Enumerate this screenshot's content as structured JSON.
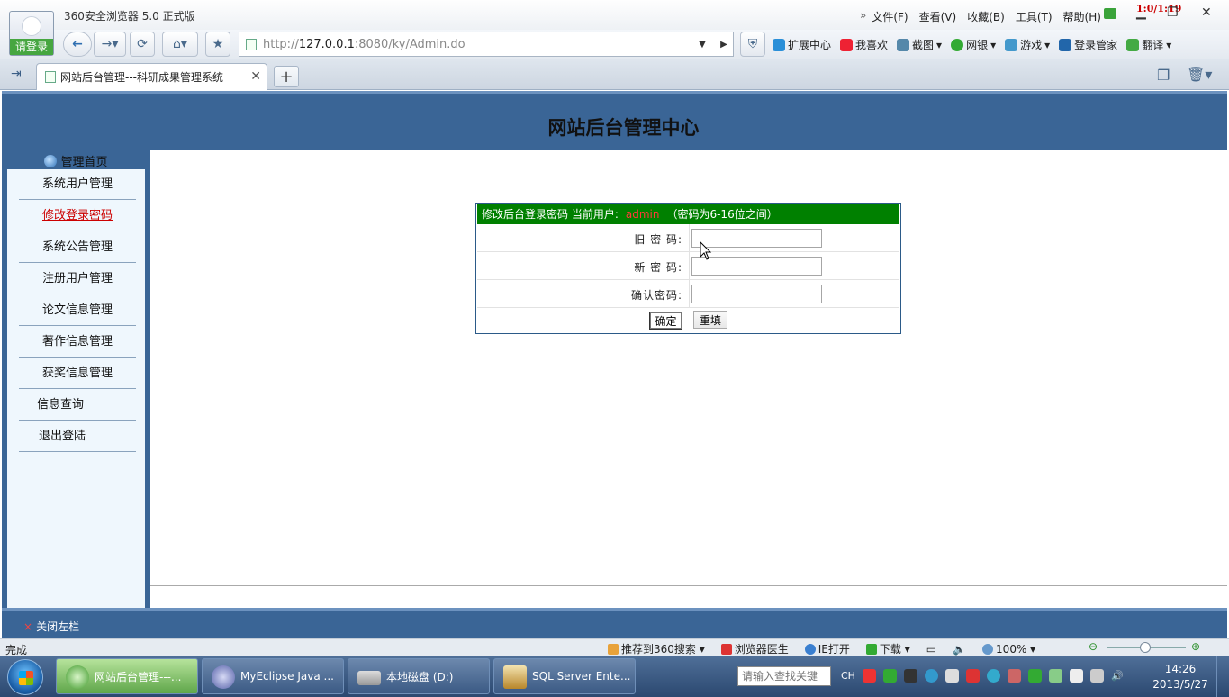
{
  "browser": {
    "login_label": "请登录",
    "app_title": "360安全浏览器 5.0 正式版",
    "menu": [
      "文件(F)",
      "查看(V)",
      "收藏(B)",
      "工具(T)",
      "帮助(H)"
    ],
    "timer": "1:0/1:19",
    "address": {
      "scheme": "http://",
      "host": "127.0.0.1",
      "rest": ":8080/ky/Admin.do"
    },
    "tools": [
      "扩展中心",
      "我喜欢",
      "截图",
      "网银",
      "游戏",
      "登录管家",
      "翻译"
    ],
    "tab_title": "网站后台管理---科研成果管理系统",
    "status_done": "完成",
    "status_items": [
      "推荐到360搜索",
      "浏览器医生",
      "IE打开",
      "下载",
      "100%"
    ],
    "colors": {
      "header": "#3a6596",
      "form_head": "#008000",
      "sidebar_bg": "#eff7fd"
    }
  },
  "page": {
    "header_title": "网站后台管理中心",
    "sidebar_home": "管理首页",
    "sidebar_items": [
      "系统用户管理",
      "修改登录密码",
      "系统公告管理",
      "注册用户管理",
      "论文信息管理",
      "著作信息管理",
      "获奖信息管理",
      "信息查询",
      "退出登陆"
    ],
    "sidebar_active_index": 1,
    "close_sidebar": "关闭左栏"
  },
  "form": {
    "header": "修改后台登录密码 当前用户:",
    "current_user": "admin",
    "hint": "（密码为6-16位之间）",
    "old_label": "旧 密 码:",
    "new_label": "新 密 码:",
    "confirm_label": "确认密码:",
    "old_value": "",
    "new_value": "",
    "confirm_value": "",
    "ok_label": "确定",
    "reset_label": "重填"
  },
  "taskbar": {
    "tasks": [
      "网站后台管理---...",
      "MyEclipse Java ...",
      "本地磁盘 (D:)",
      "SQL Server Ente..."
    ],
    "search_placeholder": "请输入查找关键",
    "lang": "CH",
    "time": "14:26",
    "date": "2013/5/27"
  }
}
